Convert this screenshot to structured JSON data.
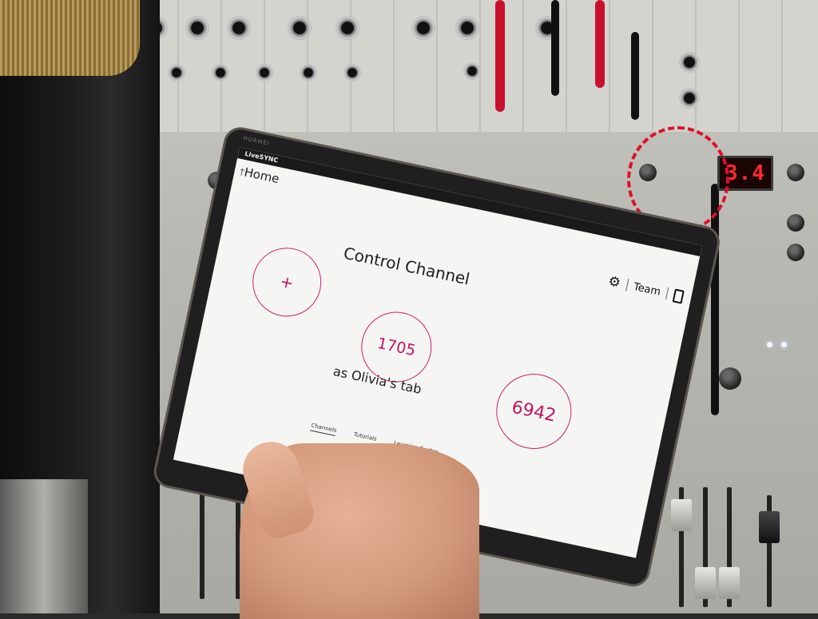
{
  "app": {
    "name": "LiveSYNC",
    "device_brand": "HUAWEI"
  },
  "header": {
    "home_label": "Home",
    "home_icon": "up-arrow-icon",
    "team_label": "Team",
    "settings_icon": "gear-icon",
    "lock_icon": "lock-icon"
  },
  "main": {
    "title": "Control Channel",
    "subtitle": "as Olivia's tab",
    "add_label": "+",
    "channels": [
      {
        "code": "1705"
      },
      {
        "code": "6942"
      }
    ]
  },
  "tabs": [
    {
      "label": "Channels",
      "active": true
    },
    {
      "label": "Tutorials",
      "active": false
    },
    {
      "label": "Learning Center",
      "active": false
    }
  ],
  "navbar": {
    "back": "◁",
    "home": "○",
    "recents": "□"
  },
  "scene": {
    "display_value": "3.4",
    "accent_color": "#d11d6e",
    "highlight_color": "#e0102a"
  }
}
